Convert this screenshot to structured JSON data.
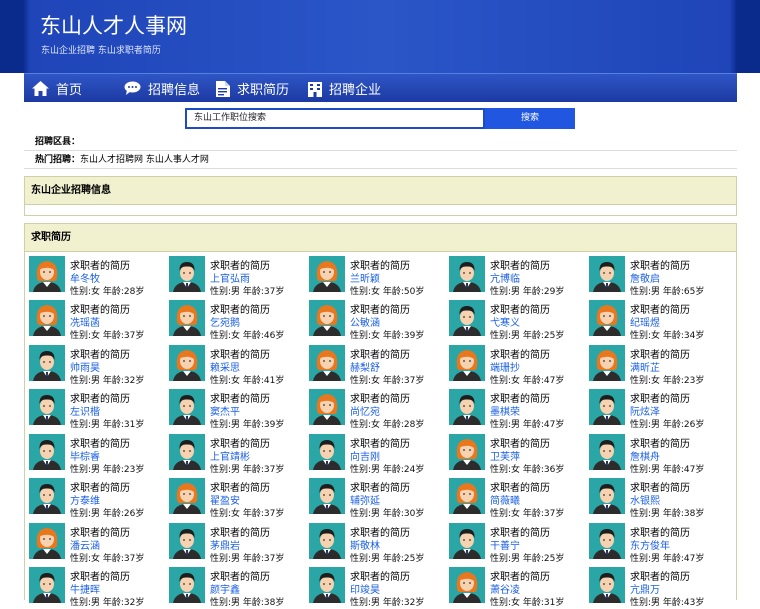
{
  "header": {
    "title": "东山人才人事网",
    "subtitle": "东山企业招聘 东山求职者简历"
  },
  "nav": [
    {
      "label": "首页",
      "icon": "home-icon"
    },
    {
      "label": "招聘信息",
      "icon": "chat-icon"
    },
    {
      "label": "求职简历",
      "icon": "document-icon"
    },
    {
      "label": "招聘企业",
      "icon": "building-icon"
    }
  ],
  "search": {
    "value": "东山工作职位搜索",
    "button": "搜索"
  },
  "filter": {
    "region_label": "招聘区县：",
    "hot_label": "热门招聘：",
    "hot_links": "东山人才招聘网 东山人事人才网"
  },
  "sections": {
    "jobs_title": "东山企业招聘信息",
    "resumes_title": "求职简历"
  },
  "colors": {
    "header_bg": "#2a56c8",
    "nav_bg": "#1d3aa2",
    "link": "#1a5fe6",
    "panel_head": "#f1f1cf",
    "avatar_bg": "#2aa6a6"
  },
  "resumes": [
    {
      "title": "求职者的简历",
      "name": "牟冬牧",
      "info": "性别:女 年龄:28岁",
      "gender": "female"
    },
    {
      "title": "求职者的简历",
      "name": "上官弘雨",
      "info": "性别:男 年龄:37岁",
      "gender": "male"
    },
    {
      "title": "求职者的简历",
      "name": "兰昕颖",
      "info": "性别:女 年龄:50岁",
      "gender": "female"
    },
    {
      "title": "求职者的简历",
      "name": "亢博临",
      "info": "性别:男 年龄:29岁",
      "gender": "male"
    },
    {
      "title": "求职者的简历",
      "name": "詹敬启",
      "info": "性别:男 年龄:65岁",
      "gender": "male"
    },
    {
      "title": "求职者的简历",
      "name": "冼瑶菡",
      "info": "性别:女 年龄:37岁",
      "gender": "female"
    },
    {
      "title": "求职者的简历",
      "name": "乞宛鹅",
      "info": "性别:女 年龄:46岁",
      "gender": "female"
    },
    {
      "title": "求职者的简历",
      "name": "公敏涵",
      "info": "性别:女 年龄:39岁",
      "gender": "female"
    },
    {
      "title": "求职者的简历",
      "name": "弋寒义",
      "info": "性别:男 年龄:25岁",
      "gender": "male"
    },
    {
      "title": "求职者的简历",
      "name": "纪瑶煜",
      "info": "性别:女 年龄:34岁",
      "gender": "female"
    },
    {
      "title": "求职者的简历",
      "name": "帅雨昊",
      "info": "性别:男 年龄:32岁",
      "gender": "male"
    },
    {
      "title": "求职者的简历",
      "name": "赖采思",
      "info": "性别:女 年龄:41岁",
      "gender": "female"
    },
    {
      "title": "求职者的简历",
      "name": "赫梨舒",
      "info": "性别:女 年龄:37岁",
      "gender": "female"
    },
    {
      "title": "求职者的简历",
      "name": "端珊抄",
      "info": "性别:女 年龄:47岁",
      "gender": "female"
    },
    {
      "title": "求职者的简历",
      "name": "满昕芷",
      "info": "性别:女 年龄:23岁",
      "gender": "female"
    },
    {
      "title": "求职者的简历",
      "name": "左识楷",
      "info": "性别:男 年龄:31岁",
      "gender": "male"
    },
    {
      "title": "求职者的简历",
      "name": "窦杰平",
      "info": "性别:男 年龄:39岁",
      "gender": "male"
    },
    {
      "title": "求职者的简历",
      "name": "尚忆宛",
      "info": "性别:女 年龄:28岁",
      "gender": "female"
    },
    {
      "title": "求职者的简历",
      "name": "墨棋荣",
      "info": "性别:男 年龄:47岁",
      "gender": "male"
    },
    {
      "title": "求职者的简历",
      "name": "阮炫泽",
      "info": "性别:男 年龄:26岁",
      "gender": "male"
    },
    {
      "title": "求职者的简历",
      "name": "毕棕睿",
      "info": "性别:男 年龄:23岁",
      "gender": "male"
    },
    {
      "title": "求职者的简历",
      "name": "上官靖彬",
      "info": "性别:男 年龄:37岁",
      "gender": "male"
    },
    {
      "title": "求职者的简历",
      "name": "向吉刚",
      "info": "性别:男 年龄:24岁",
      "gender": "male"
    },
    {
      "title": "求职者的简历",
      "name": "卫芙萍",
      "info": "性别:女 年龄:36岁",
      "gender": "female"
    },
    {
      "title": "求职者的简历",
      "name": "詹棋舟",
      "info": "性别:男 年龄:47岁",
      "gender": "male"
    },
    {
      "title": "求职者的简历",
      "name": "方泰维",
      "info": "性别:男 年龄:26岁",
      "gender": "male"
    },
    {
      "title": "求职者的简历",
      "name": "翟盈安",
      "info": "性别:女 年龄:37岁",
      "gender": "female"
    },
    {
      "title": "求职者的简历",
      "name": "辅弥延",
      "info": "性别:男 年龄:30岁",
      "gender": "male"
    },
    {
      "title": "求职者的简历",
      "name": "简薇曦",
      "info": "性别:女 年龄:37岁",
      "gender": "female"
    },
    {
      "title": "求职者的简历",
      "name": "水银熙",
      "info": "性别:男 年龄:38岁",
      "gender": "male"
    },
    {
      "title": "求职者的简历",
      "name": "潘云涵",
      "info": "性别:女 年龄:37岁",
      "gender": "female"
    },
    {
      "title": "求职者的简历",
      "name": "茅鼎岩",
      "info": "性别:男 年龄:37岁",
      "gender": "male"
    },
    {
      "title": "求职者的简历",
      "name": "斯敬林",
      "info": "性别:男 年龄:25岁",
      "gender": "male"
    },
    {
      "title": "求职者的简历",
      "name": "干善宁",
      "info": "性别:男 年龄:25岁",
      "gender": "male"
    },
    {
      "title": "求职者的简历",
      "name": "东方俊年",
      "info": "性别:男 年龄:47岁",
      "gender": "male"
    },
    {
      "title": "求职者的简历",
      "name": "牛捷晖",
      "info": "性别:男 年龄:32岁",
      "gender": "male"
    },
    {
      "title": "求职者的简历",
      "name": "颜宇鑫",
      "info": "性别:男 年龄:38岁",
      "gender": "male"
    },
    {
      "title": "求职者的简历",
      "name": "印竣昊",
      "info": "性别:男 年龄:32岁",
      "gender": "male"
    },
    {
      "title": "求职者的简历",
      "name": "萧谷凌",
      "info": "性别:女 年龄:31岁",
      "gender": "female"
    },
    {
      "title": "求职者的简历",
      "name": "亢鼎万",
      "info": "性别:男 年龄:43岁",
      "gender": "male"
    }
  ]
}
